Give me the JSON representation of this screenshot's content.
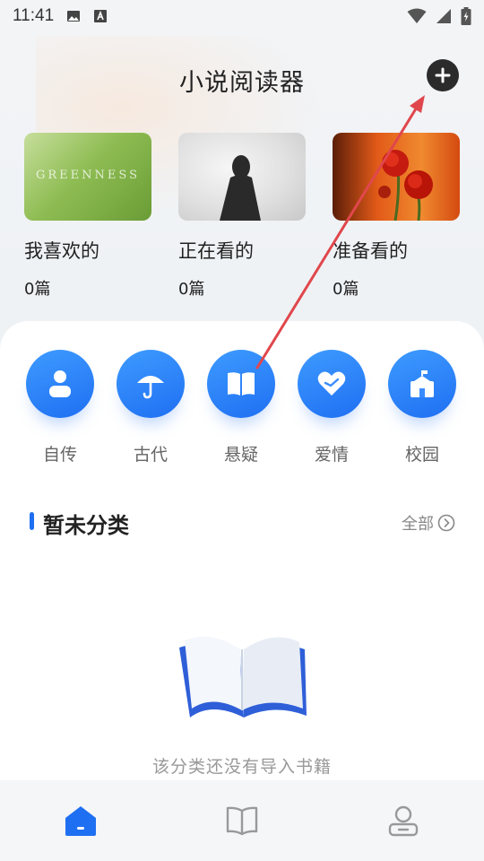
{
  "status_bar": {
    "time": "11:41",
    "icons_left": [
      "image-icon",
      "keyboard-a-icon"
    ],
    "icons_right": [
      "wifi-icon",
      "signal-icon",
      "battery-charging-icon"
    ]
  },
  "header": {
    "title": "小说阅读器",
    "add_icon": "plus-icon"
  },
  "shelves": [
    {
      "name": "我喜欢的",
      "count": "0篇",
      "cover_text": "GREENNESS"
    },
    {
      "name": "正在看的",
      "count": "0篇"
    },
    {
      "name": "准备看的",
      "count": "0篇"
    }
  ],
  "categories": [
    {
      "label": "自传",
      "icon": "person-icon"
    },
    {
      "label": "古代",
      "icon": "umbrella-icon"
    },
    {
      "label": "悬疑",
      "icon": "book-open-icon"
    },
    {
      "label": "爱情",
      "icon": "heart-icon"
    },
    {
      "label": "校园",
      "icon": "school-icon"
    }
  ],
  "section": {
    "title": "暂未分类",
    "see_all": "全部"
  },
  "empty_state": {
    "message": "该分类还没有导入书籍"
  },
  "tabbar": [
    {
      "name": "home",
      "icon": "home-icon",
      "active": true
    },
    {
      "name": "bookshelf",
      "icon": "book-icon",
      "active": false
    },
    {
      "name": "profile",
      "icon": "user-icon",
      "active": false
    }
  ],
  "colors": {
    "accent": "#1f6ff2",
    "annotation_arrow": "#e0474c"
  }
}
